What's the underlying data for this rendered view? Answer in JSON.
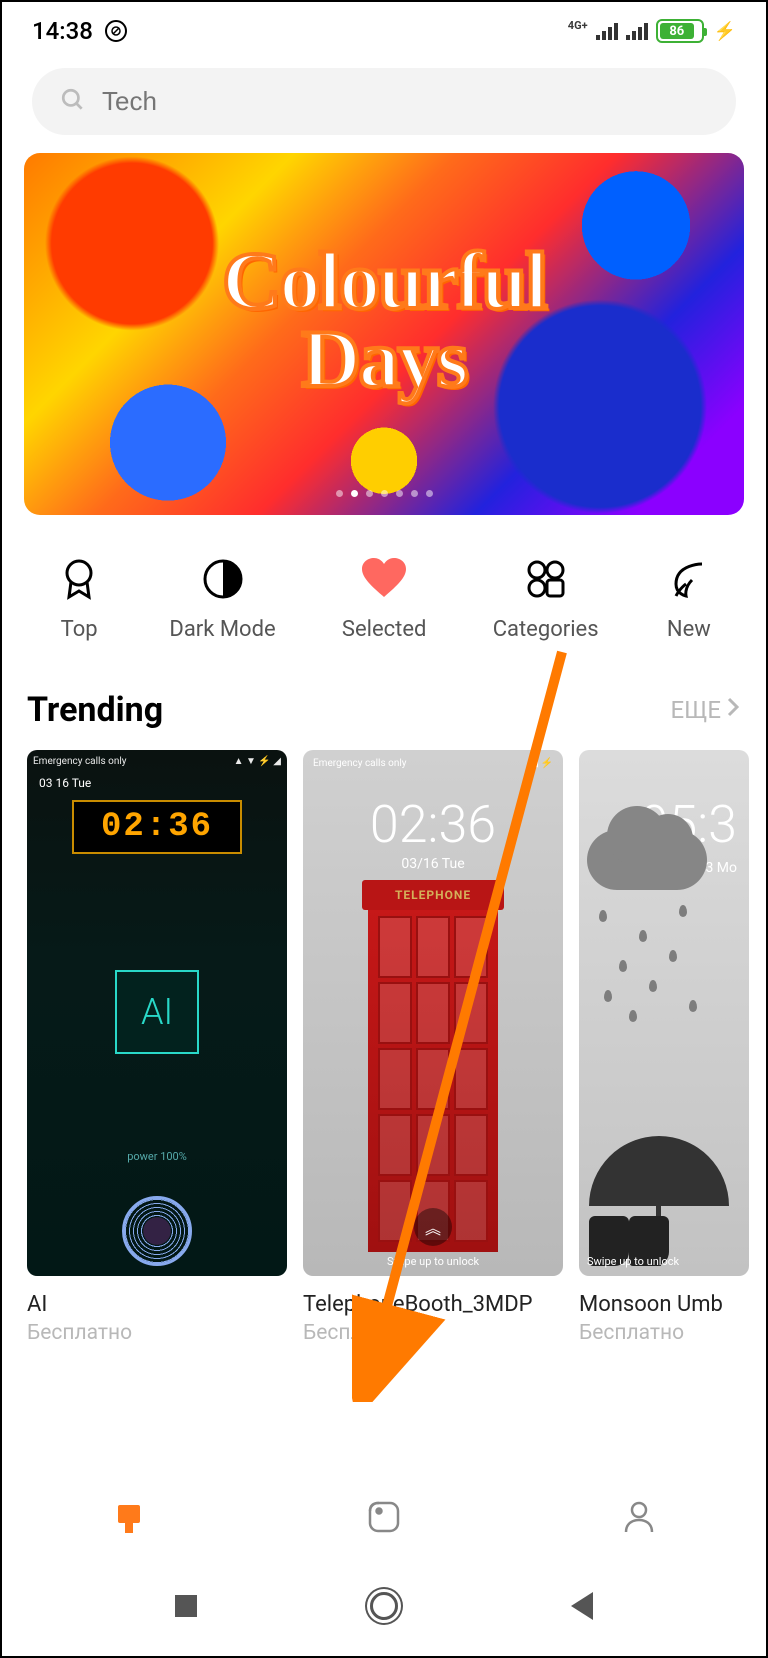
{
  "status": {
    "time": "14:38",
    "network_type": "4G+",
    "battery_pct": "86"
  },
  "search": {
    "placeholder": "Tech"
  },
  "hero": {
    "title_line1": "Colourful",
    "title_line2": "Days",
    "active_dot_index": 1,
    "total_dots": 7
  },
  "filters": [
    {
      "label": "Top",
      "icon": "medal-icon"
    },
    {
      "label": "Dark Mode",
      "icon": "contrast-icon"
    },
    {
      "label": "Selected",
      "icon": "heart-icon",
      "active": true
    },
    {
      "label": "Categories",
      "icon": "grid-icon"
    },
    {
      "label": "New",
      "icon": "leaf-icon"
    }
  ],
  "trending": {
    "header": "Trending",
    "more_label": "ЕЩЕ",
    "items": [
      {
        "name": "AI",
        "price": "Бесплатно",
        "preview": {
          "clock": "02:36",
          "date": "03 16 Tue",
          "chip_text": "AI",
          "power_text": "power 100%",
          "status_left": "Emergency calls only"
        }
      },
      {
        "name": "TelephoneBooth_3MDP",
        "price": "Бесплатно",
        "preview": {
          "clock": "02:36",
          "date": "03/16 Tue",
          "sign": "TELEPHONE",
          "swipe": "Swipe up to unlock",
          "status_left": "Emergency calls only"
        }
      },
      {
        "name": "Monsoon Umb",
        "price": "Бесплатно",
        "preview": {
          "clock": "05:3",
          "date": "07/13 Mo",
          "swipe": "Swipe up to unlock"
        }
      }
    ]
  },
  "bottom_nav": {
    "items": [
      {
        "icon": "themes-icon",
        "active": true
      },
      {
        "icon": "wallpaper-icon",
        "active": false
      },
      {
        "icon": "profile-icon",
        "active": false
      }
    ]
  }
}
